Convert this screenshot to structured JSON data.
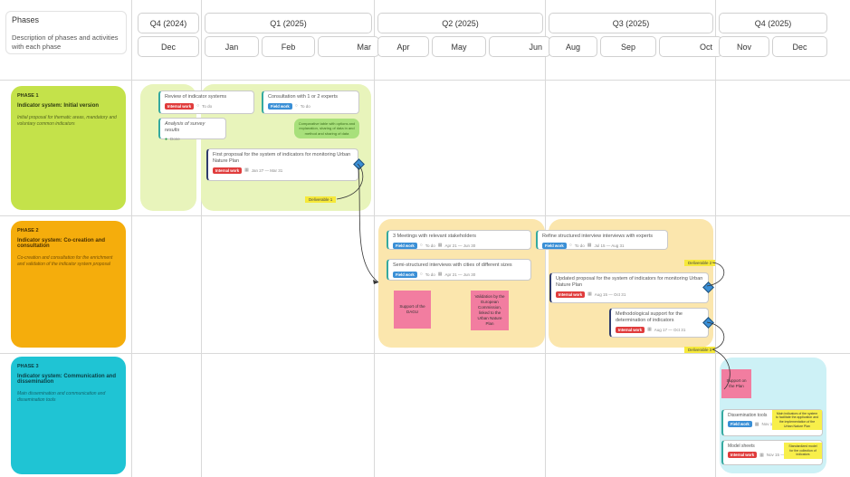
{
  "header": {
    "phases_title": "Phases",
    "phases_desc": "Description of phases and activities with each phase",
    "quarters": [
      "Q4 (2024)",
      "Q1 (2025)",
      "Q2 (2025)",
      "Q3 (2025)",
      "Q4 (2025)"
    ],
    "months": [
      "Dec",
      "Jan",
      "Feb",
      "Mar",
      "Apr",
      "May",
      "Jun",
      "Aug",
      "Sep",
      "Oct",
      "Nov",
      "Dec"
    ]
  },
  "phases": [
    {
      "label": "PHASE 1",
      "title": "Indicator system: Initial version",
      "desc": "Initial proposal for thematic areas, mandatory and voluntary common indicators"
    },
    {
      "label": "PHASE 2",
      "title": "Indicator system: Co-creation and consultation",
      "desc": "Co-creation and consultation for the enrichment and validation of the indicator system proposal"
    },
    {
      "label": "PHASE 3",
      "title": "Indicator system: Communication and dissemination",
      "desc": "Main dissemination and communication and dissemination tools"
    }
  ],
  "tags": {
    "internal": "Internal work",
    "field": "Field work"
  },
  "tasks": {
    "review": {
      "title": "Review of indicator systems",
      "meta": "To do"
    },
    "consult": {
      "title": "Consultation with 1 or 2 experts",
      "meta": "To do"
    },
    "analysis": {
      "title": "Analysis of survey results",
      "meta": "Done"
    },
    "first_proposal": {
      "title": "First proposal for the system of indicators for monitoring Urban Nature Plan",
      "meta": "Jan 27 — Mar 31"
    },
    "meetings": {
      "title": "3 Meetings with relevant stakeholders",
      "meta": "To do",
      "date": "Apr 21 — Jun 30"
    },
    "interviews": {
      "title": "Semi-structured interviews with cities of different sizes",
      "meta": "To do",
      "date": "Apr 21 — Jun 30"
    },
    "refine": {
      "title": "Refine structured interview interviews with experts",
      "meta": "To do",
      "date": "Jul 15 — Aug 31"
    },
    "updated": {
      "title": "Updated proposal for the system of indicators for monitoring Urban Nature Plan",
      "meta": "Aug 15 — Oct 31"
    },
    "method": {
      "title": "Methodological support for the determination of indicators",
      "meta": "Aug 17 — Oct 31"
    },
    "dissemination": {
      "title": "Dissemination tools",
      "meta": "Nov 10"
    },
    "model": {
      "title": "Model sheets",
      "meta": "Nov 15 — Dec 31"
    }
  },
  "stickies": {
    "support": "Support of the DAGU",
    "validation": "Validation by the European Commission, linked to the Urban Nature Plan",
    "green_note": "Comparative table with options and explanation, sharing of data in and method and sharing of data",
    "pink3": "Support on the Plan",
    "yellow1": "Main indicators of the system to facilitate the application and the implementation of the Urban Nature Plan",
    "yellow2": "Standardized model for the collection of indicators"
  },
  "deliverables": {
    "d1": "Deliverable 1",
    "d2": "Deliverable 2",
    "d3": "Deliverable 3"
  },
  "colors": {
    "phase1": "#c4e24a",
    "phase2": "#f5ad0c",
    "phase3": "#1fc4d4",
    "zone1": "#e8f4bb",
    "zone2": "#fbe6ad",
    "zone3": "#cdf1f6"
  }
}
